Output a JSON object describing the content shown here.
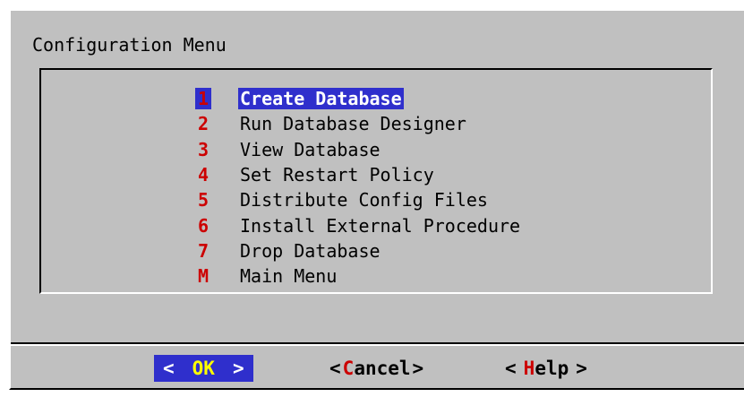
{
  "dialog": {
    "title": "Configuration Menu"
  },
  "menu": {
    "selected_index": 0,
    "items": [
      {
        "key": "1",
        "label": "Create Database"
      },
      {
        "key": "2",
        "label": "Run Database Designer"
      },
      {
        "key": "3",
        "label": "View Database"
      },
      {
        "key": "4",
        "label": "Set Restart Policy"
      },
      {
        "key": "5",
        "label": "Distribute Config Files"
      },
      {
        "key": "6",
        "label": "Install External Procedure"
      },
      {
        "key": "7",
        "label": "Drop Database"
      },
      {
        "key": "M",
        "label": "Main Menu"
      }
    ]
  },
  "buttons": {
    "ok": {
      "left": "<",
      "hot": "OK",
      "rest": "",
      "right": ">"
    },
    "cancel": {
      "left": "<",
      "hot": "C",
      "rest": "ancel",
      "right": ">"
    },
    "help": {
      "left": "<",
      "hot": "H",
      "rest": "elp",
      "right": ">"
    }
  },
  "colors": {
    "dialog_background": "#c0c0c0",
    "selection_background": "#2f2fcc",
    "hotkey": "#cc0000",
    "ok_hotkey": "#ffff00"
  }
}
